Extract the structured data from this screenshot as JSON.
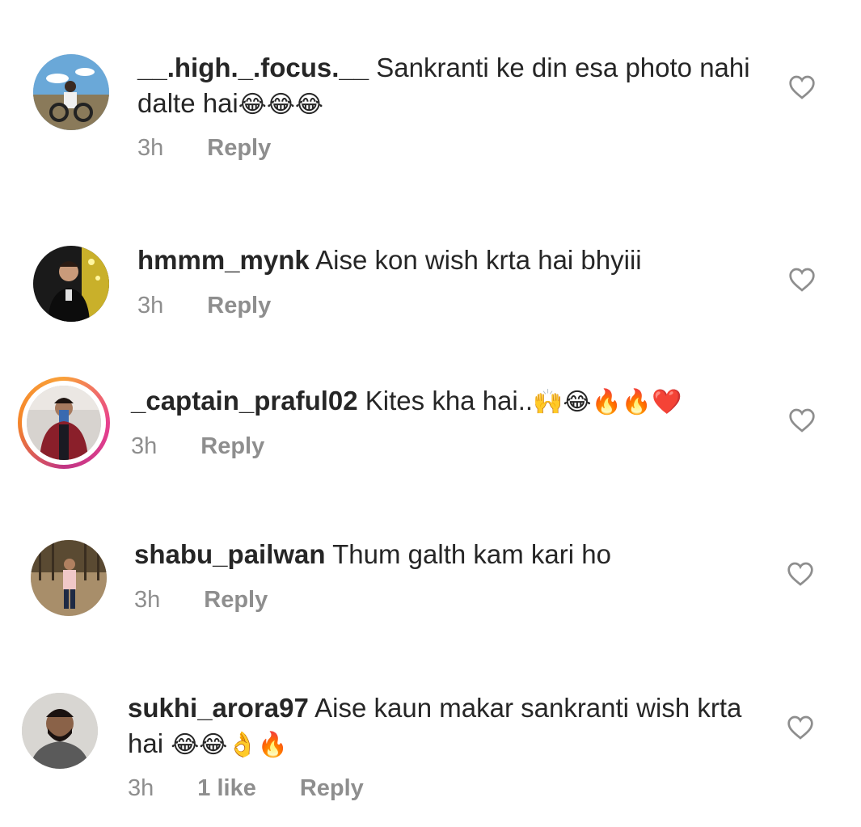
{
  "comments": [
    {
      "username": "__.high._.focus.__",
      "text": "Sankranti ke din esa photo nahi dalte hai",
      "emojis": "😂😂😂",
      "time": "3h",
      "likes": "",
      "reply_label": "Reply",
      "has_story": false
    },
    {
      "username": "hmmm_mynk",
      "text": "Aise kon wish krta hai bhyiii",
      "emojis": "",
      "time": "3h",
      "likes": "",
      "reply_label": "Reply",
      "has_story": false
    },
    {
      "username": "_captain_praful02",
      "text": "Kites kha hai..",
      "emojis": "🙌😂🔥🔥❤️",
      "time": "3h",
      "likes": "",
      "reply_label": "Reply",
      "has_story": true
    },
    {
      "username": "shabu_pailwan",
      "text": "Thum galth kam kari ho",
      "emojis": "",
      "time": "3h",
      "likes": "",
      "reply_label": "Reply",
      "has_story": false
    },
    {
      "username": "sukhi_arora97",
      "text": "Aise kaun makar sankranti wish krta hai",
      "emojis": "😂😂👌🔥",
      "time": "3h",
      "likes": "1 like",
      "reply_label": "Reply",
      "has_story": false
    }
  ],
  "icons": {
    "like": "heart-outline-icon"
  },
  "colors": {
    "text": "#262626",
    "meta": "#8e8e8e",
    "heart_stroke": "#8e8e8e"
  }
}
